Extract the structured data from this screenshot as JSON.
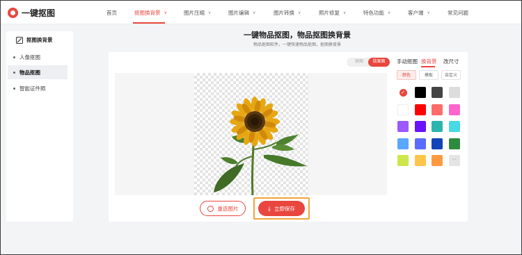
{
  "brand": {
    "name": "一键抠图",
    "color": "#e8463e"
  },
  "nav": {
    "items": [
      {
        "label": "首页",
        "dropdown": false
      },
      {
        "label": "抠图换背景",
        "dropdown": true
      },
      {
        "label": "图片压缩",
        "dropdown": true
      },
      {
        "label": "图片编辑",
        "dropdown": true
      },
      {
        "label": "图片转换",
        "dropdown": true
      },
      {
        "label": "照片修复",
        "dropdown": true
      },
      {
        "label": "特色功能",
        "dropdown": true
      },
      {
        "label": "客户端",
        "dropdown": true
      },
      {
        "label": "常见问题",
        "dropdown": false
      }
    ],
    "active_index": 1
  },
  "sidebar": {
    "title": "抠图换背景",
    "items": [
      {
        "label": "人像抠图"
      },
      {
        "label": "物品抠图"
      },
      {
        "label": "智能证件照"
      }
    ],
    "active_index": 1
  },
  "main": {
    "title": "一键物品抠图，物品抠图换背景",
    "subtitle": "物品抠图软件，一键快速物品抠图，抠图换背景"
  },
  "view_toggle": {
    "original": "原图",
    "result": "效果图",
    "selected": "效果图"
  },
  "panel": {
    "tabs": [
      "手动抠图",
      "换背景",
      "改尺寸"
    ],
    "active_tab": "换背景",
    "subtabs": [
      "颜色",
      "模板",
      "自定义"
    ],
    "active_subtab": "颜色",
    "colors": [
      "#ffffff",
      "#000000",
      "#444444",
      "#dddddd",
      "#ffffff",
      "#ff0000",
      "#ff6b6b",
      "#ff66cc",
      "#9b59ff",
      "#6a11ff",
      "#2eb4ae",
      "#48d8e6",
      "#5aa7ff",
      "#5c6cff",
      "#1445b8",
      "#2e8b3e",
      "#cde64a",
      "#ffc54a",
      "#ff9a40",
      "#e5e5e5"
    ],
    "selected_color_index": 0,
    "more_label": "···"
  },
  "actions": {
    "reselect": "重选图片",
    "save": "立即保存"
  },
  "icons": [
    "logo-icon",
    "cutout-icon",
    "chevron-down-icon",
    "checkmark-icon",
    "download-icon",
    "refresh-icon"
  ]
}
